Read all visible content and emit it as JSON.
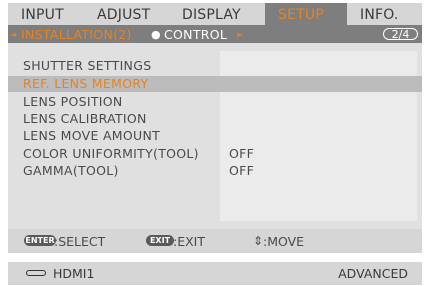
{
  "tabs": [
    {
      "label": "INPUT",
      "active": false
    },
    {
      "label": "ADJUST",
      "active": false
    },
    {
      "label": "DISPLAY",
      "active": false
    },
    {
      "label": "SETUP",
      "active": true
    },
    {
      "label": "INFO.",
      "active": false
    }
  ],
  "subheader": {
    "left_arrow": "◄",
    "current": "INSTALLATION(2)",
    "separator": "●",
    "next": "CONTROL",
    "right_arrow": "►",
    "page_indicator": "2/4"
  },
  "menu_items": [
    {
      "label": "SHUTTER SETTINGS",
      "value": "",
      "selected": false
    },
    {
      "label": "REF. LENS MEMORY",
      "value": "",
      "selected": true
    },
    {
      "label": "LENS POSITION",
      "value": "",
      "selected": false
    },
    {
      "label": "LENS CALIBRATION",
      "value": "",
      "selected": false
    },
    {
      "label": "LENS MOVE AMOUNT",
      "value": "",
      "selected": false
    },
    {
      "label": "COLOR UNIFORMITY(TOOL)",
      "value": "OFF",
      "selected": false
    },
    {
      "label": "GAMMA(TOOL)",
      "value": "OFF",
      "selected": false
    }
  ],
  "footer": {
    "enter_key": "ENTER",
    "enter_hint": ":SELECT",
    "exit_key": "EXIT",
    "exit_hint": ":EXIT",
    "move_icon": "⇕",
    "move_hint": ":MOVE"
  },
  "status": {
    "input_icon": "hdmi-connector-icon",
    "source": "HDMI1",
    "mode": "ADVANCED"
  },
  "colors": {
    "accent": "#e8821e",
    "tab_active_bg": "#7e7e7e",
    "selected_row_bg": "#bcbcbc",
    "panel_bg": "#e0e0e0"
  }
}
